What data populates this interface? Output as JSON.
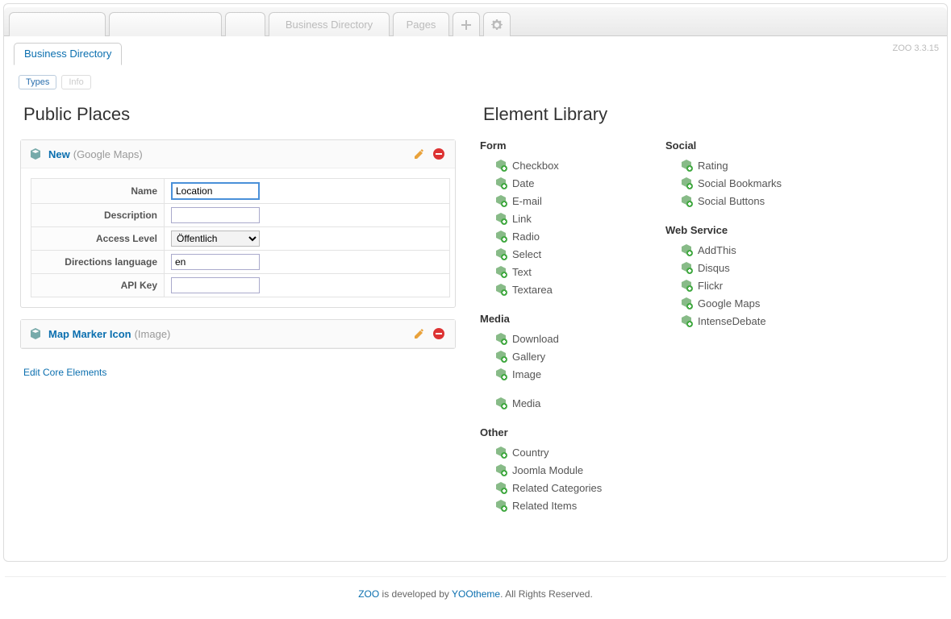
{
  "topbar": {
    "tabs": [
      "",
      "",
      "",
      "Business Directory",
      "Pages"
    ],
    "version": "ZOO 3.3.15"
  },
  "subtabs": {
    "active": "Business Directory"
  },
  "pills": {
    "types": "Types",
    "info": "Info"
  },
  "left": {
    "title": "Public Places",
    "panels": [
      {
        "name": "New",
        "type": "(Google Maps)",
        "fields": {
          "name_label": "Name",
          "name_value": "Location",
          "description_label": "Description",
          "description_value": "",
          "access_label": "Access Level",
          "access_value": "Öffentlich",
          "dirlang_label": "Directions language",
          "dirlang_value": "en",
          "apikey_label": "API Key",
          "apikey_value": ""
        }
      },
      {
        "name": "Map Marker Icon",
        "type": "(Image)"
      }
    ],
    "edit_core": "Edit Core Elements"
  },
  "right": {
    "title": "Element Library",
    "columns": [
      [
        {
          "group": "Form",
          "items": [
            "Checkbox",
            "Date",
            "E-mail",
            "Link",
            "Radio",
            "Select",
            "Text",
            "Textarea"
          ]
        },
        {
          "group": "Media",
          "items": [
            "Download",
            "Gallery",
            "Image"
          ],
          "tail_items": [
            "Media"
          ]
        },
        {
          "group": "Other",
          "items": [
            "Country",
            "Joomla Module",
            "Related Categories",
            "Related Items"
          ]
        }
      ],
      [
        {
          "group": "Social",
          "items": [
            "Rating",
            "Social Bookmarks",
            "Social Buttons"
          ]
        },
        {
          "group": "Web Service",
          "items": [
            "AddThis",
            "Disqus",
            "Flickr",
            "Google Maps",
            "IntenseDebate"
          ]
        }
      ]
    ]
  },
  "footer": {
    "prefix_link": "ZOO",
    "mid": " is developed by ",
    "link2": "YOOtheme",
    "suffix": ". All Rights Reserved."
  }
}
